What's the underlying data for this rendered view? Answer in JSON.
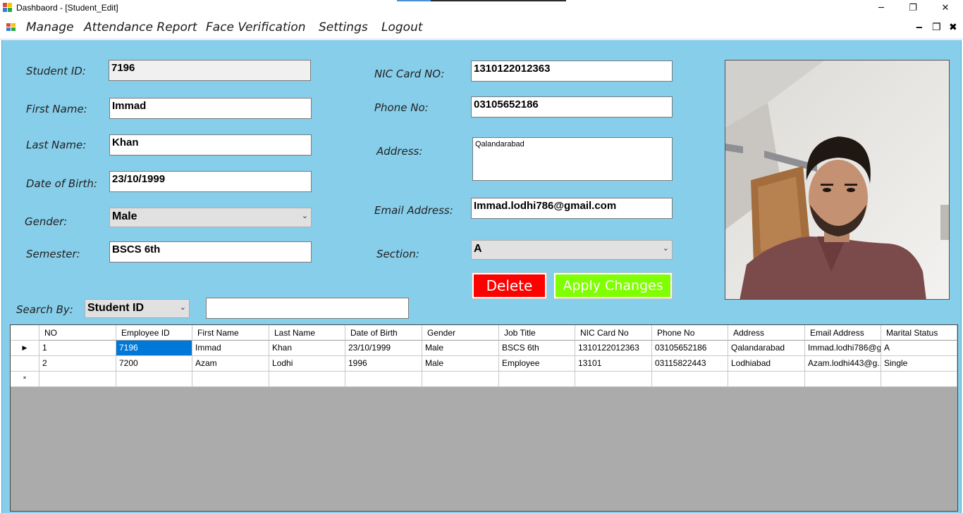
{
  "window": {
    "title": "Dashbaord - [Student_Edit]",
    "controls": {
      "minimize": "─",
      "restore": "❐",
      "close": "✕"
    }
  },
  "menu": {
    "items": [
      "Manage",
      "Attendance Report",
      "Face Verification",
      "Settings",
      "Logout"
    ],
    "mdi_controls": {
      "minimize": "‒",
      "restore": "❐",
      "close": "✖"
    }
  },
  "form": {
    "student_id": {
      "label": "Student ID:",
      "value": "7196"
    },
    "first_name": {
      "label": "First Name:",
      "value": "Immad"
    },
    "last_name": {
      "label": "Last Name:",
      "value": "Khan"
    },
    "dob": {
      "label": "Date of Birth:",
      "value": "23/10/1999"
    },
    "gender": {
      "label": "Gender:",
      "value": "Male"
    },
    "semester": {
      "label": "Semester:",
      "value": "BSCS 6th"
    },
    "nic": {
      "label": "NIC Card NO:",
      "value": "1310122012363"
    },
    "phone": {
      "label": "Phone No:",
      "value": "03105652186"
    },
    "address": {
      "label": "Address:",
      "value": "Qalandarabad"
    },
    "email": {
      "label": "Email Address:",
      "value": "Immad.lodhi786@gmail.com"
    },
    "section": {
      "label": "Section:",
      "value": "A"
    },
    "delete_label": "Delete",
    "apply_label": "Apply Changes"
  },
  "search": {
    "label": "Search By:",
    "field": "Student ID",
    "query": ""
  },
  "grid": {
    "columns": [
      "NO",
      "Employee ID",
      "First Name",
      "Last Name",
      "Date of Birth",
      "Gender",
      "Job Title",
      "NIC Card No",
      "Phone No",
      "Address",
      "Email Address",
      "Marital Status"
    ],
    "rows": [
      [
        "1",
        "7196",
        "Immad",
        "Khan",
        "23/10/1999",
        "Male",
        "BSCS 6th",
        "1310122012363",
        "03105652186",
        "Qalandarabad",
        "Immad.lodhi786@g...",
        "A"
      ],
      [
        "2",
        "7200",
        "Azam",
        "Lodhi",
        "1996",
        "Male",
        "Employee",
        "13101",
        "03115822443",
        "Lodhiabad",
        "Azam.lodhi443@g...",
        "Single"
      ]
    ],
    "current_row_marker": "▶",
    "new_row_marker": "*"
  },
  "colors": {
    "form_bg": "#87ceeb",
    "delete": "#ff0000",
    "apply": "#7fff00",
    "selection": "#0078d7",
    "grid_bg": "#ababab"
  },
  "icons": {
    "photo": "student-photo"
  }
}
